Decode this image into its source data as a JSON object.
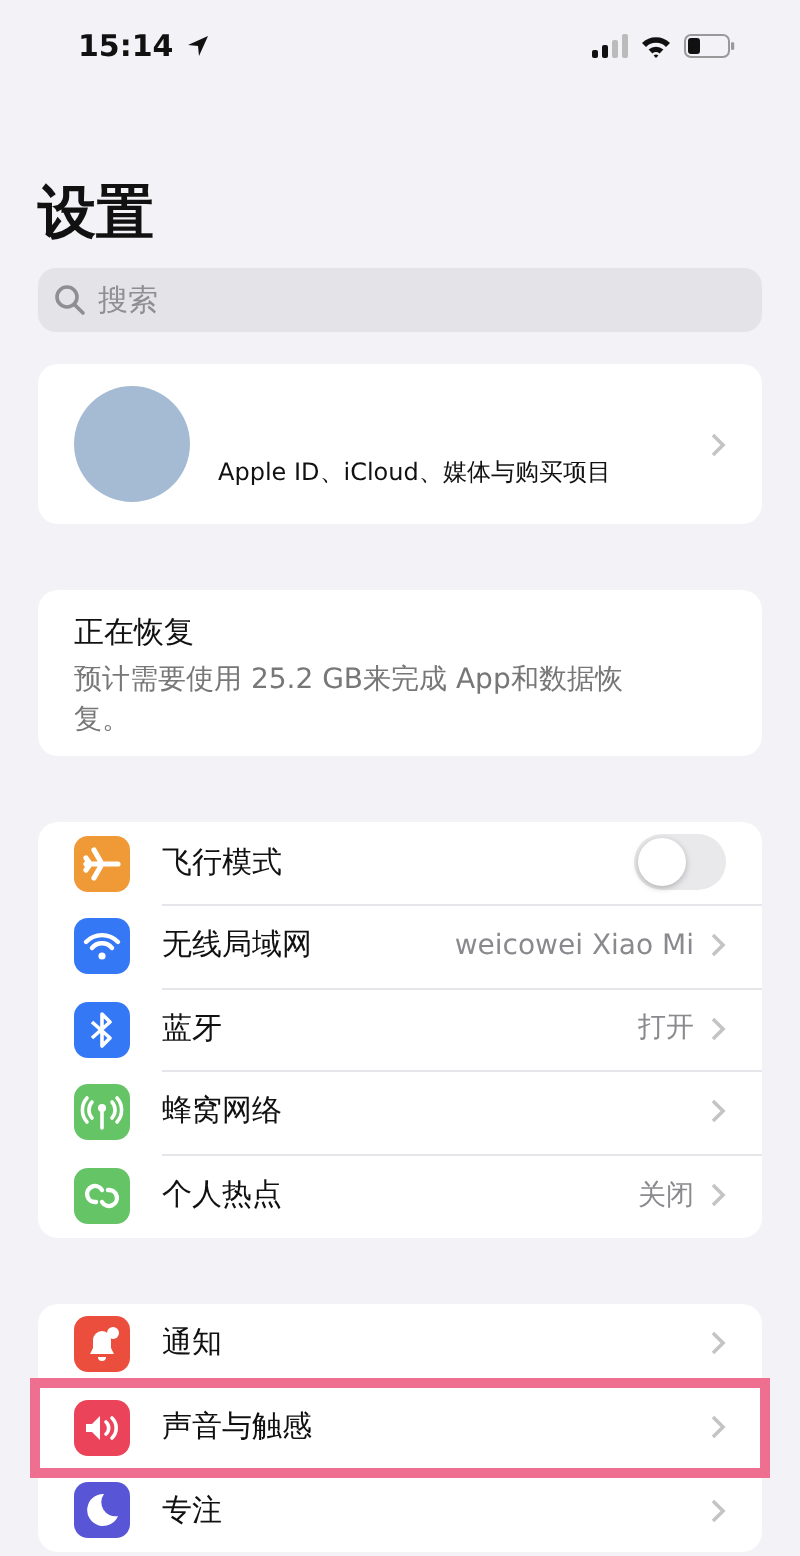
{
  "status_bar": {
    "time": "15:14"
  },
  "title": "设置",
  "search": {
    "placeholder": "搜索"
  },
  "account": {
    "subtitle": "Apple ID、iCloud、媒体与购买项目"
  },
  "restore": {
    "title": "正在恢复",
    "text": "预计需要使用 25.2 GB来完成 App和数据恢复。"
  },
  "groups": [
    {
      "rows": [
        {
          "kind": "toggle",
          "label": "飞行模式",
          "color": "#f09a37",
          "on": false,
          "highlighted": false
        },
        {
          "kind": "link",
          "label": "无线局域网",
          "value": "weicowei Xiao Mi",
          "color": "#3478f6",
          "highlighted": false
        },
        {
          "kind": "link",
          "label": "蓝牙",
          "value": "打开",
          "color": "#3478f6",
          "highlighted": false
        },
        {
          "kind": "link",
          "label": "蜂窝网络",
          "color": "#65c466",
          "highlighted": false
        },
        {
          "kind": "link",
          "label": "个人热点",
          "value": "关闭",
          "color": "#65c466",
          "highlighted": false
        }
      ]
    },
    {
      "rows": [
        {
          "kind": "link",
          "label": "通知",
          "color": "#eb4e3d",
          "highlighted": false
        },
        {
          "kind": "link",
          "label": "声音与触感",
          "color": "#eb445a",
          "highlighted": true
        },
        {
          "kind": "link",
          "label": "专注",
          "color": "#5856d6",
          "highlighted": false
        }
      ]
    }
  ]
}
